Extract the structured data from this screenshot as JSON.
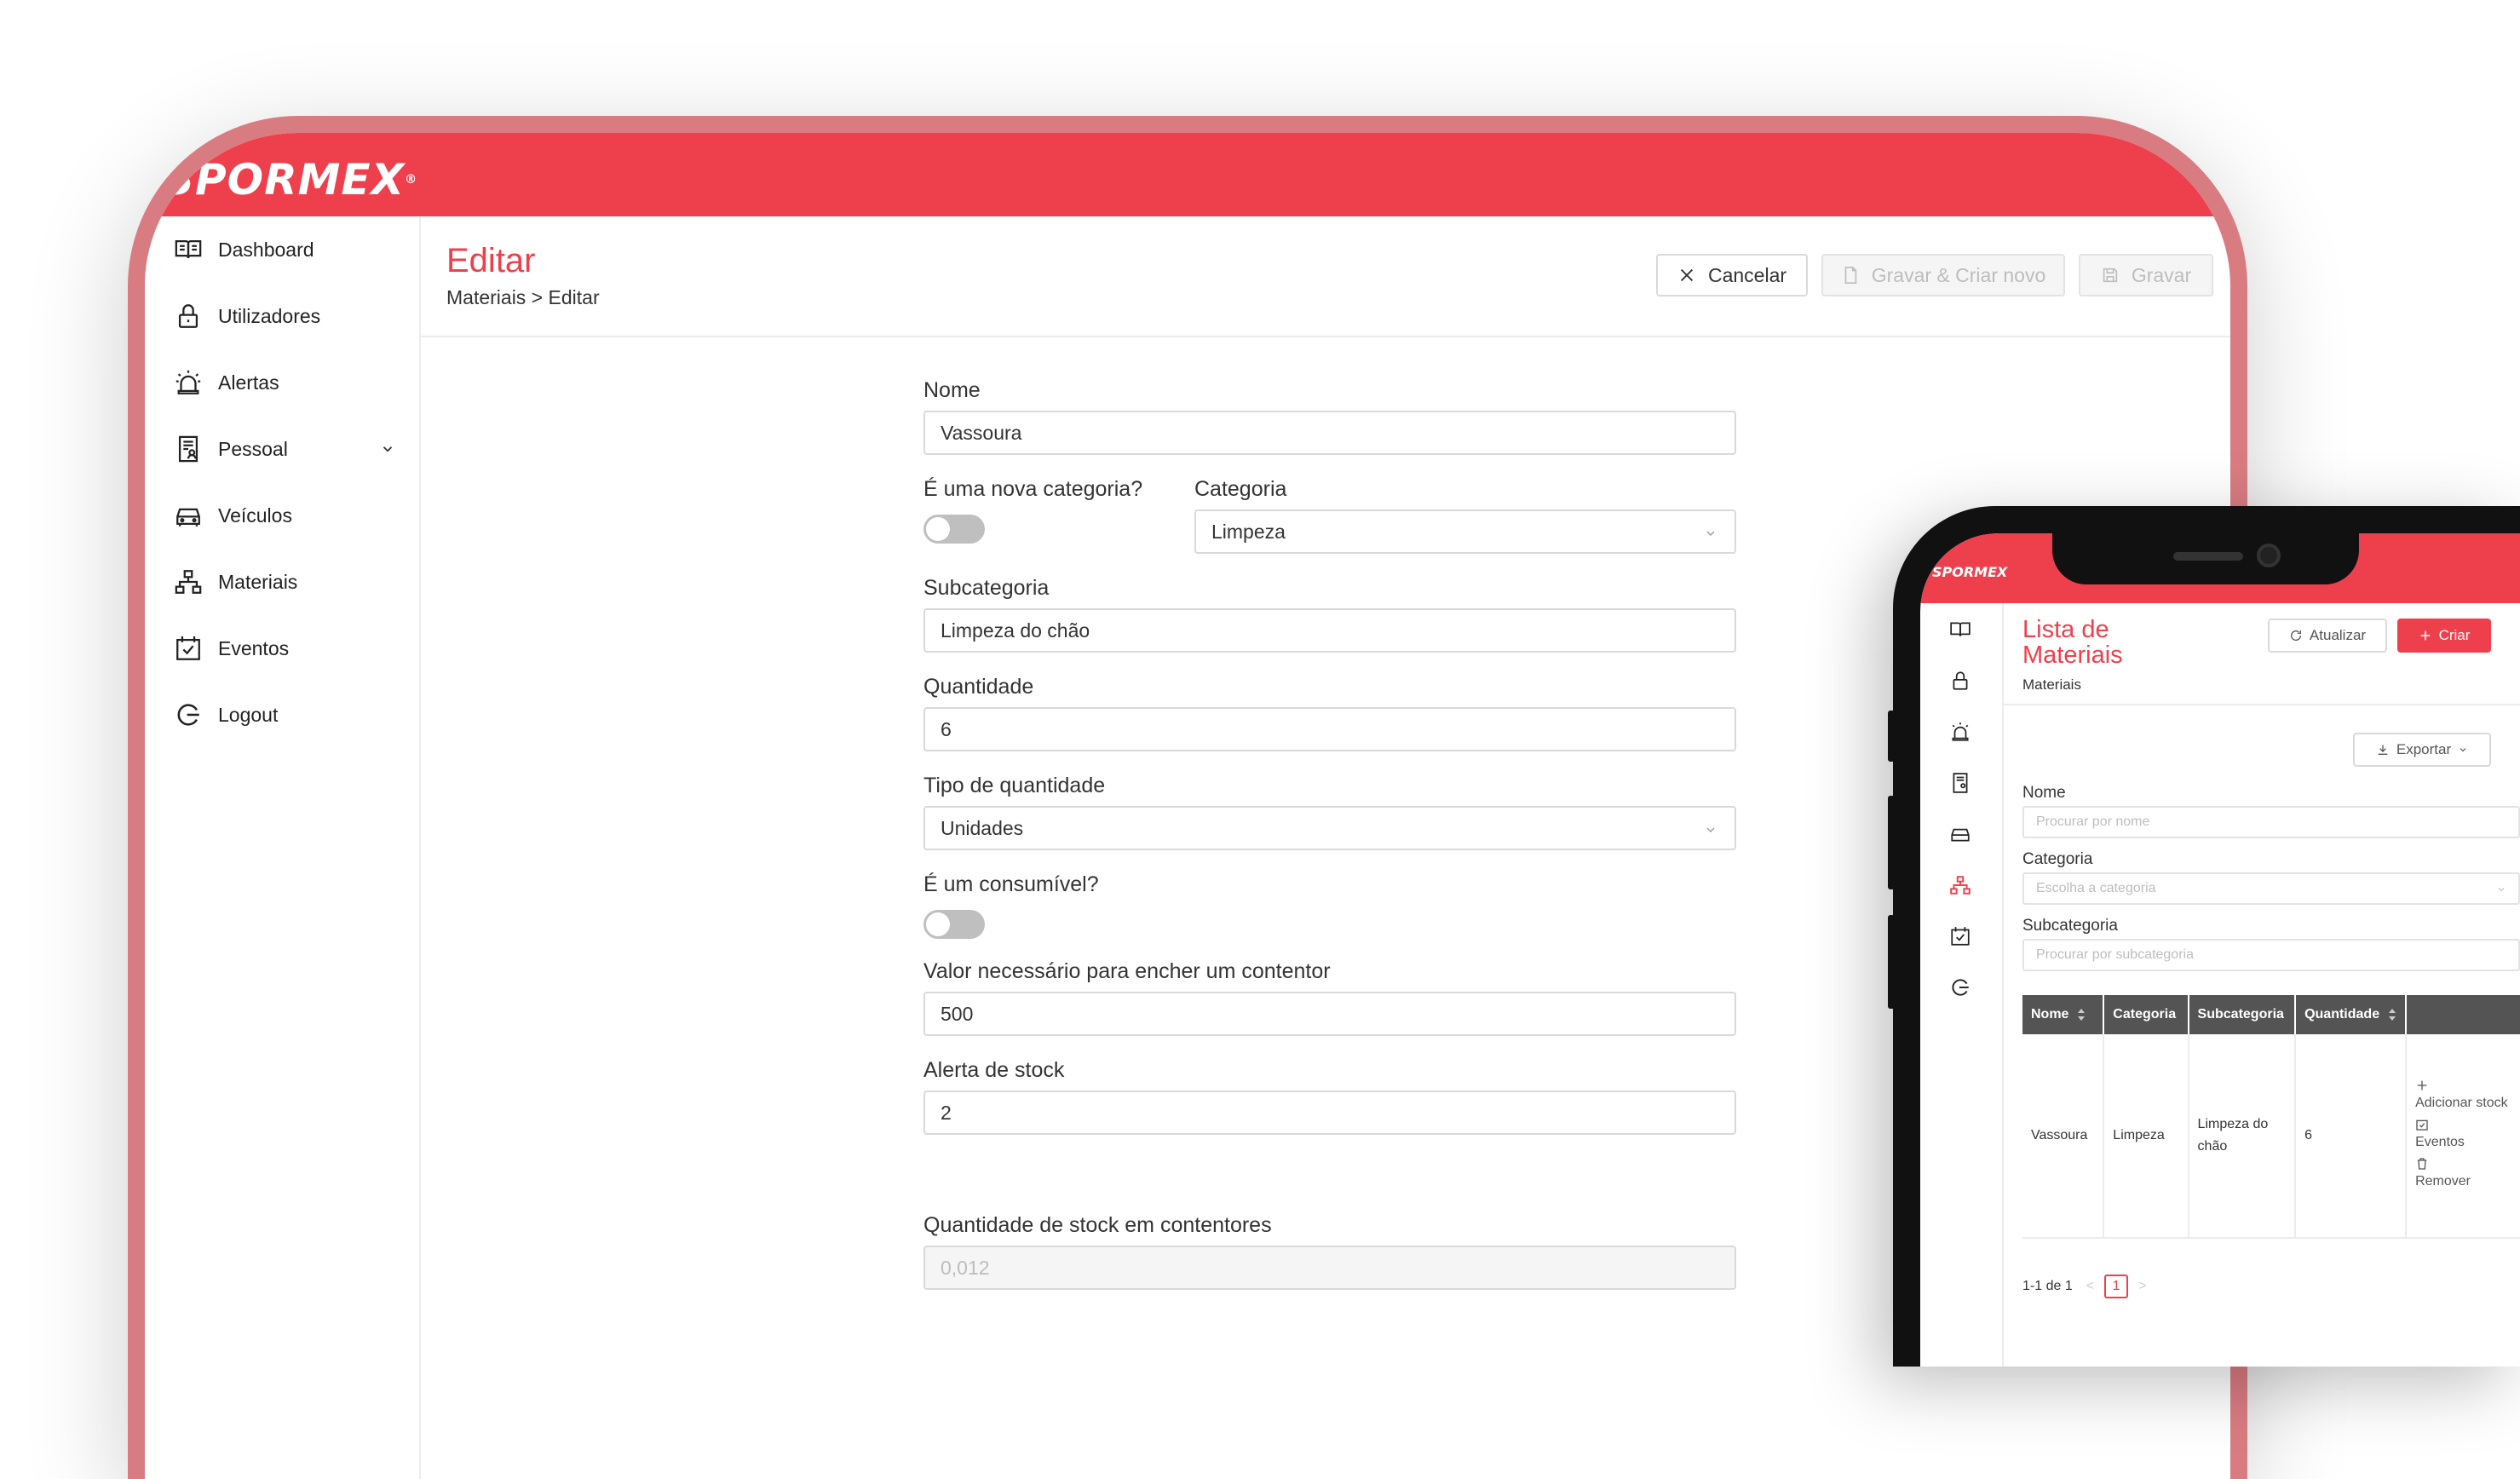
{
  "brand": {
    "logo": "SPORMEX",
    "accent": "#ee404c"
  },
  "tablet": {
    "sidebar": {
      "items": [
        {
          "label": "Dashboard",
          "icon": "book-icon"
        },
        {
          "label": "Utilizadores",
          "icon": "lock-icon"
        },
        {
          "label": "Alertas",
          "icon": "alarm-icon"
        },
        {
          "label": "Pessoal",
          "icon": "document-person-icon",
          "expandable": true
        },
        {
          "label": "Veículos",
          "icon": "car-icon"
        },
        {
          "label": "Materiais",
          "icon": "cluster-icon"
        },
        {
          "label": "Eventos",
          "icon": "calendar-check-icon"
        },
        {
          "label": "Logout",
          "icon": "logout-icon"
        }
      ]
    },
    "page": {
      "title": "Editar",
      "breadcrumb": "Materiais > Editar",
      "buttons": {
        "cancel": "Cancelar",
        "save_new": "Gravar & Criar novo",
        "save": "Gravar"
      }
    },
    "form": {
      "nome": {
        "label": "Nome",
        "value": "Vassoura"
      },
      "nova_categoria": {
        "label": "É uma nova categoria?",
        "checked": false
      },
      "categoria": {
        "label": "Categoria",
        "value": "Limpeza"
      },
      "subcategoria": {
        "label": "Subcategoria",
        "value": "Limpeza do chão"
      },
      "quantidade": {
        "label": "Quantidade",
        "value": "6"
      },
      "tipo_quantidade": {
        "label": "Tipo de quantidade",
        "value": "Unidades"
      },
      "consumivel": {
        "label": "É um consumível?",
        "checked": false
      },
      "valor_contentor": {
        "label": "Valor necessário para encher um contentor",
        "value": "500"
      },
      "alerta_stock": {
        "label": "Alerta de stock",
        "value": "2"
      },
      "stock_contentores": {
        "label": "Quantidade de stock em contentores",
        "value": "0,012"
      }
    }
  },
  "phone": {
    "logo": "SPORMEX",
    "page": {
      "title": "Lista de Materiais",
      "breadcrumb": "Materiais",
      "buttons": {
        "refresh": "Atualizar",
        "create": "Criar",
        "export": "Exportar"
      }
    },
    "filters": {
      "nome": {
        "label": "Nome",
        "placeholder": "Procurar por nome"
      },
      "categoria": {
        "label": "Categoria",
        "placeholder": "Escolha a categoria"
      },
      "subcategoria": {
        "label": "Subcategoria",
        "placeholder": "Procurar por subcategoria"
      }
    },
    "table": {
      "columns": [
        "Nome",
        "Categoria",
        "Subcategoria",
        "Quantidade"
      ],
      "rows": [
        {
          "nome": "Vassoura",
          "categoria": "Limpeza",
          "subcategoria": "Limpeza do chão",
          "quantidade": "6"
        }
      ],
      "actions": {
        "add_stock": "Adicionar stock",
        "events": "Eventos",
        "remove": "Remover"
      }
    },
    "pagination": {
      "summary": "1-1 de 1",
      "prev": "<",
      "current": "1",
      "next": ">"
    }
  }
}
